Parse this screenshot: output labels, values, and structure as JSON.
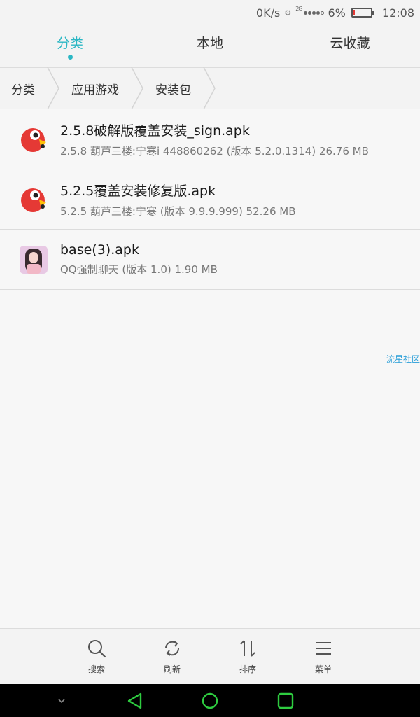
{
  "status": {
    "speed": "0K/s",
    "network": "2G",
    "battery": "6%",
    "time": "12:08"
  },
  "tabs": [
    {
      "label": "分类",
      "active": true
    },
    {
      "label": "本地",
      "active": false
    },
    {
      "label": "云收藏",
      "active": false
    }
  ],
  "breadcrumb": [
    "分类",
    "应用游戏",
    "安装包"
  ],
  "files": [
    {
      "name": "2.5.8破解版覆盖安装_sign.apk",
      "meta": "2.5.8  葫芦三楼:宁寒i 448860262 (版本 5.2.0.1314) 26.76 MB",
      "icon": "parrot-app-icon"
    },
    {
      "name": "5.2.5覆盖安装修复版.apk",
      "meta": "5.2.5 葫芦三楼:宁寒 (版本 9.9.9.999) 52.26 MB",
      "icon": "parrot-app-icon"
    },
    {
      "name": "base(3).apk",
      "meta": "QQ强制聊天 (版本 1.0) 1.90 MB",
      "icon": "girl-avatar-icon"
    }
  ],
  "watermark": "流星社区",
  "toolbar": {
    "search_label": "搜索",
    "refresh_label": "刷新",
    "sort_label": "排序",
    "menu_label": "菜单"
  },
  "colors": {
    "accent": "#2bb7c4",
    "background": "#f7f7f7",
    "navbar_icons": "#2ecc40"
  }
}
